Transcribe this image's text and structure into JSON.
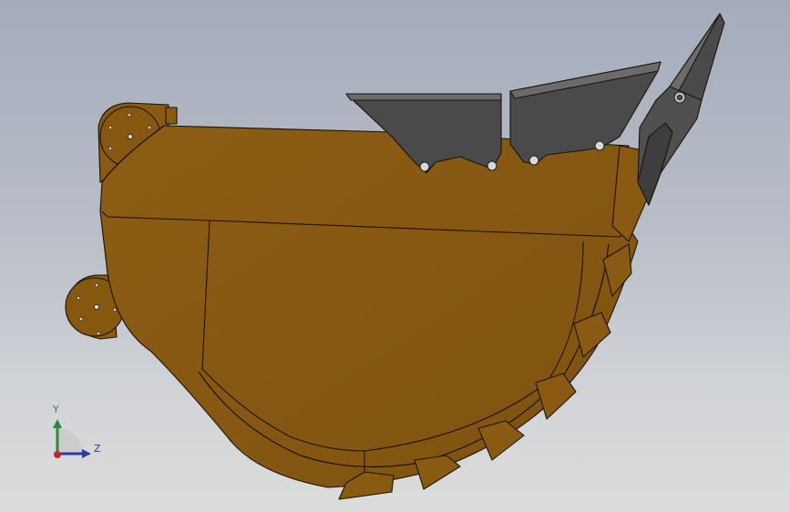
{
  "viewport": {
    "background_top": "#a4acbb",
    "background_bottom": "#dcdcdc"
  },
  "model": {
    "part": "excavator-bucket",
    "body_color": "#8a5a12",
    "body_shade": "#7a4e0e",
    "steel_color": "#4a4a4a"
  },
  "triad": {
    "y_label": "Y",
    "z_label": "Z",
    "y_color": "#2a8a3c",
    "z_color": "#2c3f9a",
    "x_color": "#c0282b"
  }
}
